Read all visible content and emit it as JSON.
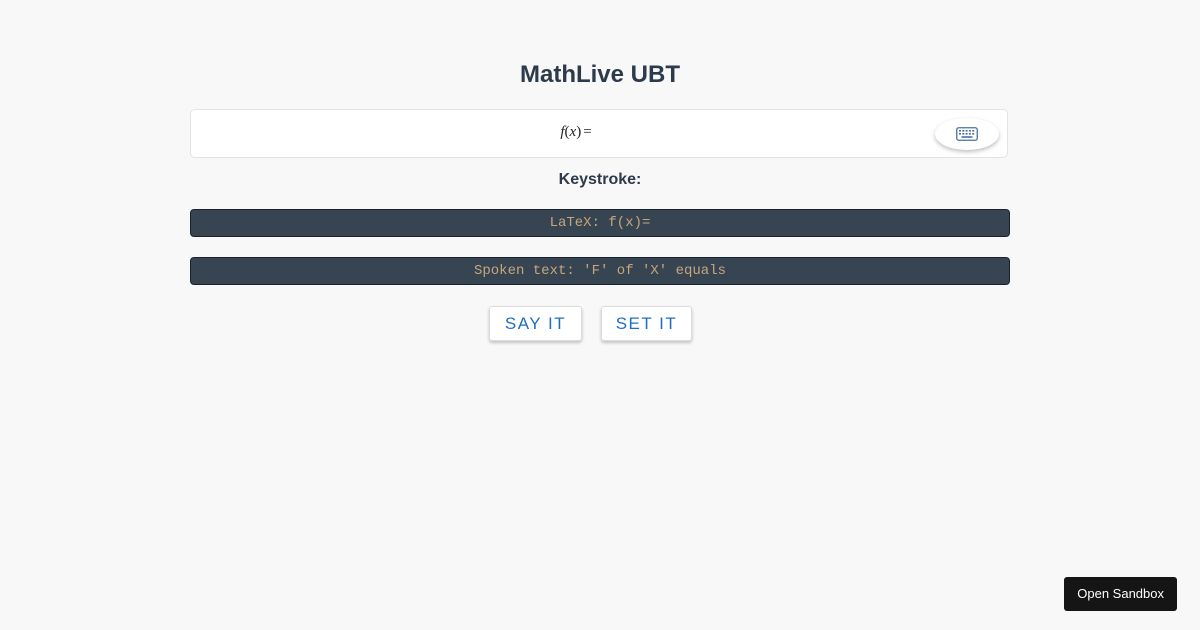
{
  "page": {
    "title": "MathLive UBT"
  },
  "math_field": {
    "function_name": "f",
    "open_paren": "(",
    "variable": "x",
    "close_paren": ")",
    "equals": "=",
    "keyboard_toggle_icon": "keyboard-icon"
  },
  "keystroke": {
    "label": "Keystroke:"
  },
  "outputs": {
    "latex": "LaTeX: f(x)=",
    "spoken": "Spoken text: 'F' of 'X' equals"
  },
  "buttons": {
    "say_it": "SAY IT",
    "set_it": "SET IT"
  },
  "sandbox": {
    "label": "Open Sandbox"
  },
  "colors": {
    "background": "#f8f8f8",
    "title_text": "#2d3a4b",
    "output_bg": "#374451",
    "output_text": "#c6a77c",
    "button_text": "#1f6fbf",
    "sandbox_bg": "#151515"
  }
}
